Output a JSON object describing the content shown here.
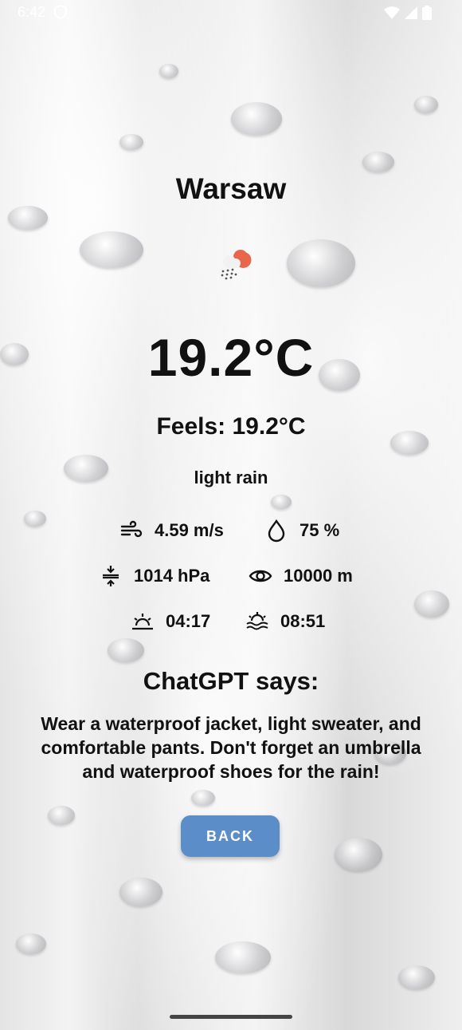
{
  "status_bar": {
    "time": "6:42"
  },
  "city": "Warsaw",
  "weather_icon": "cloud-rain-sun-icon",
  "temperature": "19.2°C",
  "feels_like": "Feels: 19.2°C",
  "description": "light rain",
  "stats": {
    "wind": "4.59 m/s",
    "humidity": "75 %",
    "pressure": "1014 hPa",
    "visibility": "10000 m",
    "sunrise": "04:17",
    "sunset": "08:51"
  },
  "chatgpt": {
    "title": "ChatGPT says:",
    "text": "Wear a waterproof jacket, light sweater, and comfortable pants. Don't forget an umbrella and waterproof shoes for the rain!"
  },
  "back_button": "BACK",
  "colors": {
    "button": "#5b8ec9",
    "sun": "#e8664a"
  }
}
